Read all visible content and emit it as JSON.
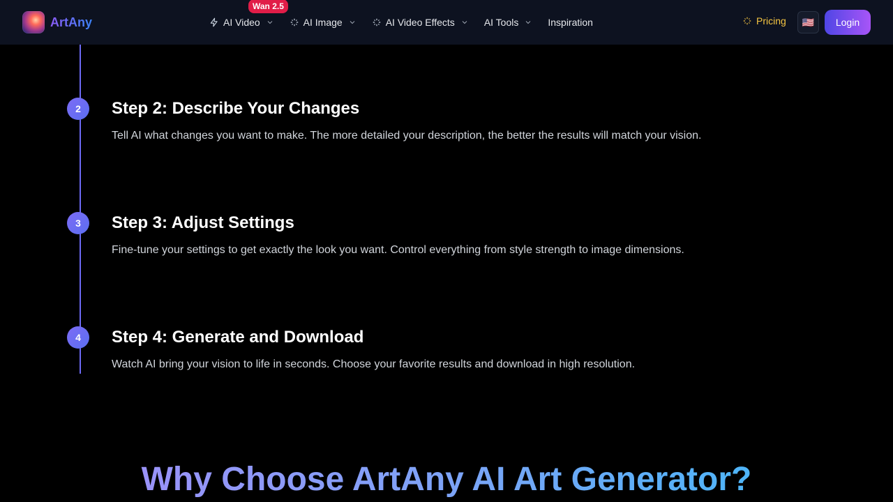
{
  "header": {
    "logo_text": "ArtAny",
    "nav": [
      {
        "label": "AI Video",
        "badge": "Wan 2.5",
        "icon": "bolt-icon"
      },
      {
        "label": "AI Image",
        "icon": "sparkle-icon"
      },
      {
        "label": "AI Video Effects",
        "icon": "sparkle-icon"
      },
      {
        "label": "AI Tools"
      },
      {
        "label": "Inspiration"
      }
    ],
    "pricing_label": "Pricing",
    "language_flag": "🇺🇸",
    "login_label": "Login"
  },
  "steps": [
    {
      "number": "2",
      "title": "Step 2: Describe Your Changes",
      "description": "Tell AI what changes you want to make. The more detailed your description, the better the results will match your vision."
    },
    {
      "number": "3",
      "title": "Step 3: Adjust Settings",
      "description": "Fine-tune your settings to get exactly the look you want. Control everything from style strength to image dimensions."
    },
    {
      "number": "4",
      "title": "Step 4: Generate and Download",
      "description": "Watch AI bring your vision to life in seconds. Choose your favorite results and download in high resolution."
    }
  ],
  "section_heading": "Why Choose ArtAny AI Art Generator?",
  "colors": {
    "accent": "#6d6af5",
    "pricing": "#f5c542",
    "badge": "#e11d48",
    "background": "#000000"
  }
}
